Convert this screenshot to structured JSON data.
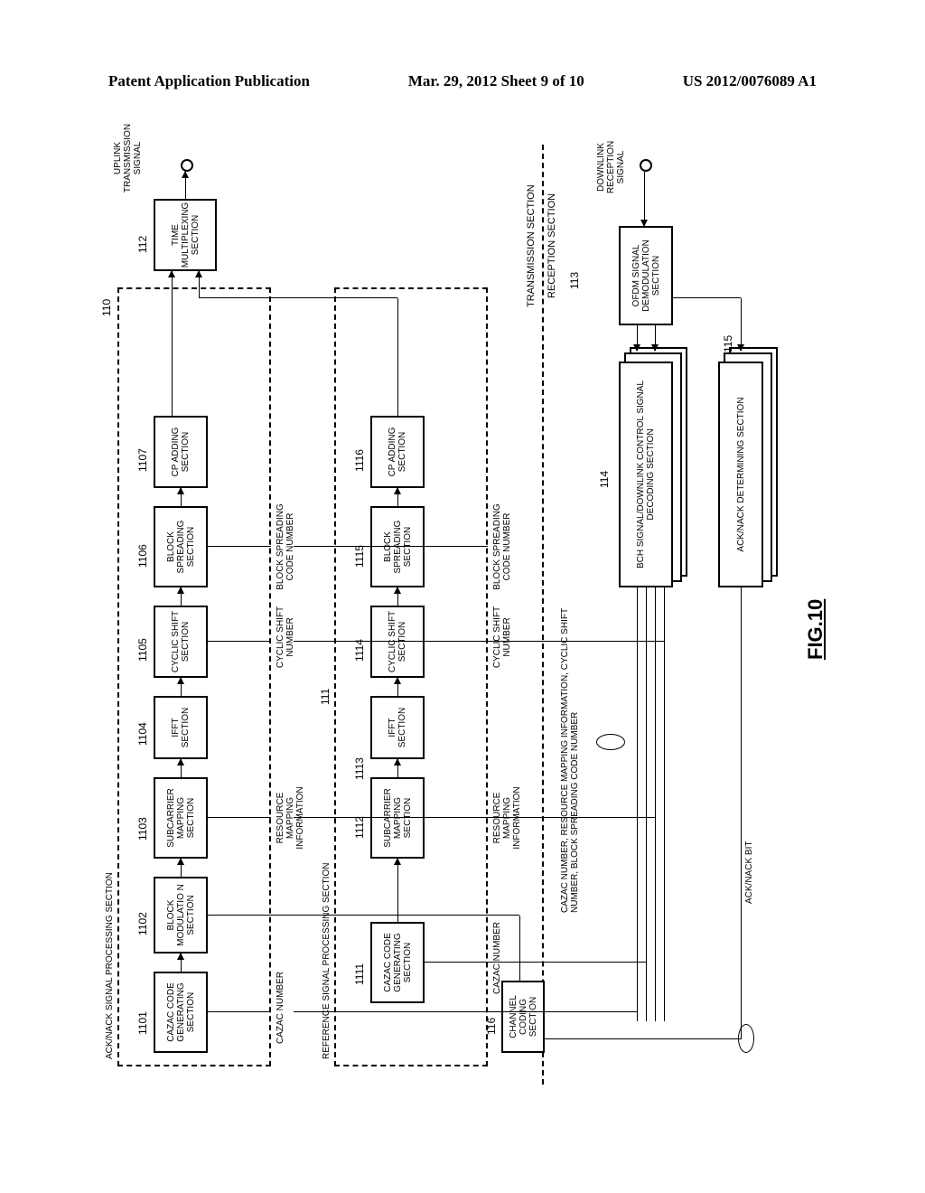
{
  "header": {
    "left": "Patent Application Publication",
    "center": "Mar. 29, 2012  Sheet 9 of 10",
    "right": "US 2012/0076089 A1"
  },
  "figure_label": "FIG.10",
  "sections": {
    "acknack_title": "ACK/NACK SIGNAL PROCESSING SECTION",
    "ref_title": "REFERENCE SIGNAL PROCESSING SECTION",
    "tx": "TRANSMISSION SECTION",
    "rx": "RECEPTION SECTION"
  },
  "nums": {
    "n110": "110",
    "n111": "111",
    "n112": "112",
    "n113": "113",
    "n114": "114",
    "n115": "115",
    "n116": "116",
    "n1101": "1101",
    "n1102": "1102",
    "n1103": "1103",
    "n1104": "1104",
    "n1105": "1105",
    "n1106": "1106",
    "n1107": "1107",
    "n1111": "1111",
    "n1112": "1112",
    "n1113": "1113",
    "n1114": "1114",
    "n1115": "1115",
    "n1116": "1116"
  },
  "boxes": {
    "ch_coding": "CHANNEL CODING SECTION",
    "cazac_gen_a": "CAZAC CODE GENERATING SECTION",
    "block_mod": "BLOCK MODULATIO N SECTION",
    "sub_map_a": "SUBCARRIER MAPPING SECTION",
    "ifft_a": "IFFT SECTION",
    "cyc_shift_a": "CYCLIC SHIFT SECTION",
    "blk_spread_a": "BLOCK SPREADING SECTION",
    "cp_add_a": "CP ADDING SECTION",
    "cazac_gen_r": "CAZAC CODE GENERATING SECTION",
    "sub_map_r": "SUBCARRIER MAPPING SECTION",
    "ifft_r": "IFFT SECTION",
    "cyc_shift_r": "CYCLIC SHIFT SECTION",
    "blk_spread_r": "BLOCK SPREADING SECTION",
    "cp_add_r": "CP ADDING SECTION",
    "tmux": "TIME MULTIPLEXING SECTION",
    "ofdm_demod": "OFDM SIGNAL DEMODULATION SECTION",
    "bch_decode": "BCH SIGNAL/DOWNLINK CONTROL SIGNAL DECODING SECTION",
    "ack_det": "ACK/NACK DETERMINING SECTION"
  },
  "signals": {
    "uplink": "UPLINK TRANSMISSION SIGNAL",
    "downlink": "DOWNLINK RECEPTION SIGNAL",
    "ack_bit": "ACK/NACK BIT",
    "cazac_num": "CAZAC NUMBER",
    "res_map_info": "RESOURCE MAPPING INFORMATION",
    "cyc_shift_num": "CYCLIC SHIFT NUMBER",
    "blk_spr_num": "BLOCK SPREADING CODE NUMBER",
    "long_bus": "CAZAC NUMBER, RESOURCE MAPPING INFORMATION, CYCLIC SHIFT NUMBER, BLOCK SPREADING CODE NUMBER"
  }
}
